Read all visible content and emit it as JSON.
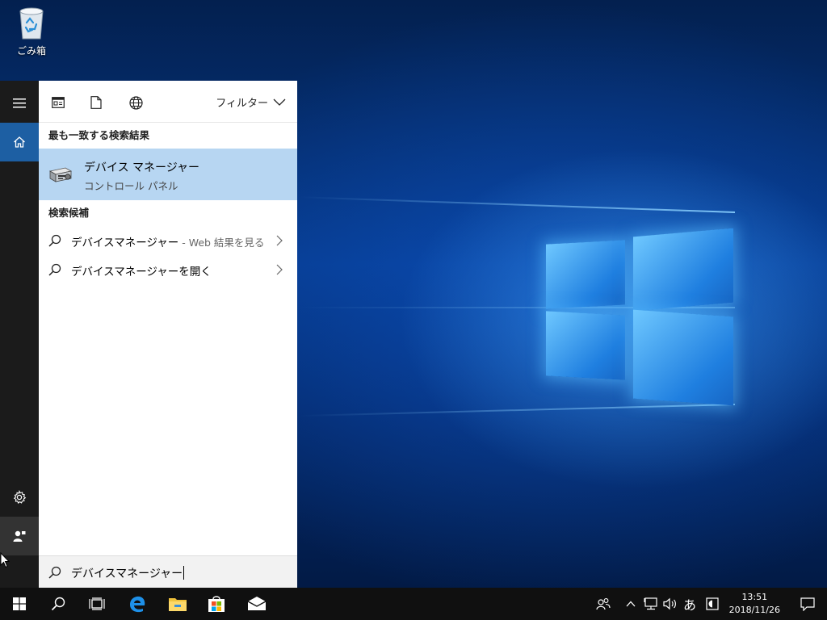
{
  "desktop": {
    "recycle_bin_label": "ごみ箱"
  },
  "start_rail": {
    "items": [
      {
        "icon": "hamburger-menu-icon"
      },
      {
        "icon": "home-icon"
      },
      {
        "icon": "gear-icon"
      },
      {
        "icon": "user-account-icon"
      }
    ]
  },
  "search_panel": {
    "filter_label": "フィルター",
    "best_match_header": "最も一致する検索結果",
    "best_match": {
      "title": "デバイス マネージャー",
      "subtitle": "コントロール パネル"
    },
    "suggestions_header": "検索候補",
    "suggestions": [
      {
        "text": "デバイスマネージャー",
        "suffix": " - Web 結果を見る"
      },
      {
        "text": "デバイスマネージャーを開く",
        "suffix": ""
      }
    ],
    "query": "デバイスマネージャー"
  },
  "taskbar": {
    "ime_mode": "あ",
    "time": "13:51",
    "date": "2018/11/26"
  },
  "colors": {
    "accent": "#1d5fa3",
    "selection": "#b7d6f2",
    "taskbar": "#101010",
    "rail": "#1b1b1b"
  }
}
